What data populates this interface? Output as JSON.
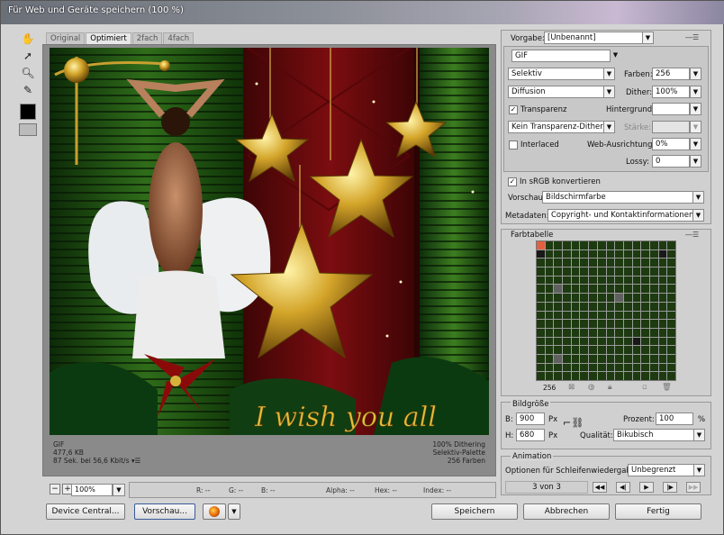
{
  "window": {
    "title": "Für Web und Geräte speichern (100 %)"
  },
  "tabs": [
    "Original",
    "Optimiert",
    "2fach",
    "4fach"
  ],
  "artwork": {
    "caption": "I wish you all"
  },
  "image_info": {
    "format": "GIF",
    "size": "477,6 KB",
    "time": "87 Sek. bei 56,6 Kbit/s",
    "dither": "100% Dithering",
    "palette": "Selektiv-Palette",
    "colors": "256 Farben"
  },
  "zoom": {
    "value": "100%"
  },
  "readout": {
    "r": "R: --",
    "g": "G: --",
    "b": "B: --",
    "alpha": "Alpha: --",
    "hex": "Hex: --",
    "index": "Index: --"
  },
  "buttons": {
    "device_central": "Device Central...",
    "preview": "Vorschau...",
    "save": "Speichern",
    "cancel": "Abbrechen",
    "done": "Fertig"
  },
  "settings": {
    "preset_label": "Vorgabe:",
    "preset_value": "[Unbenannt]",
    "format": "GIF",
    "reduction": "Selektiv",
    "colors_label": "Farben:",
    "colors_value": "256",
    "dither_algo": "Diffusion",
    "dither_label": "Dither:",
    "dither_value": "100%",
    "transparency_label": "Transparenz",
    "matte_label": "Hintergrund:",
    "transp_dither": "Kein Transparenz-Dither",
    "amount_label": "Stärke:",
    "interlaced_label": "Interlaced",
    "websnap_label": "Web-Ausrichtung:",
    "websnap_value": "0%",
    "lossy_label": "Lossy:",
    "lossy_value": "0",
    "srgb_label": "In sRGB konvertieren",
    "preview_label": "Vorschau:",
    "preview_value": "Bildschirmfarbe",
    "metadata_label": "Metadaten:",
    "metadata_value": "Copyright- und Kontaktinformationen"
  },
  "color_table": {
    "title": "Farbtabelle",
    "count": "256"
  },
  "image_size": {
    "title": "Bildgröße",
    "w_label": "B:",
    "w_value": "900",
    "h_label": "H:",
    "h_value": "680",
    "unit": "Px",
    "percent_label": "Prozent:",
    "percent_value": "100",
    "percent_unit": "%",
    "quality_label": "Qualität:",
    "quality_value": "Bikubisch"
  },
  "animation": {
    "title": "Animation",
    "loop_label": "Optionen für Schleifenwiedergabe:",
    "loop_value": "Unbegrenzt",
    "frame": "3 von 3"
  }
}
